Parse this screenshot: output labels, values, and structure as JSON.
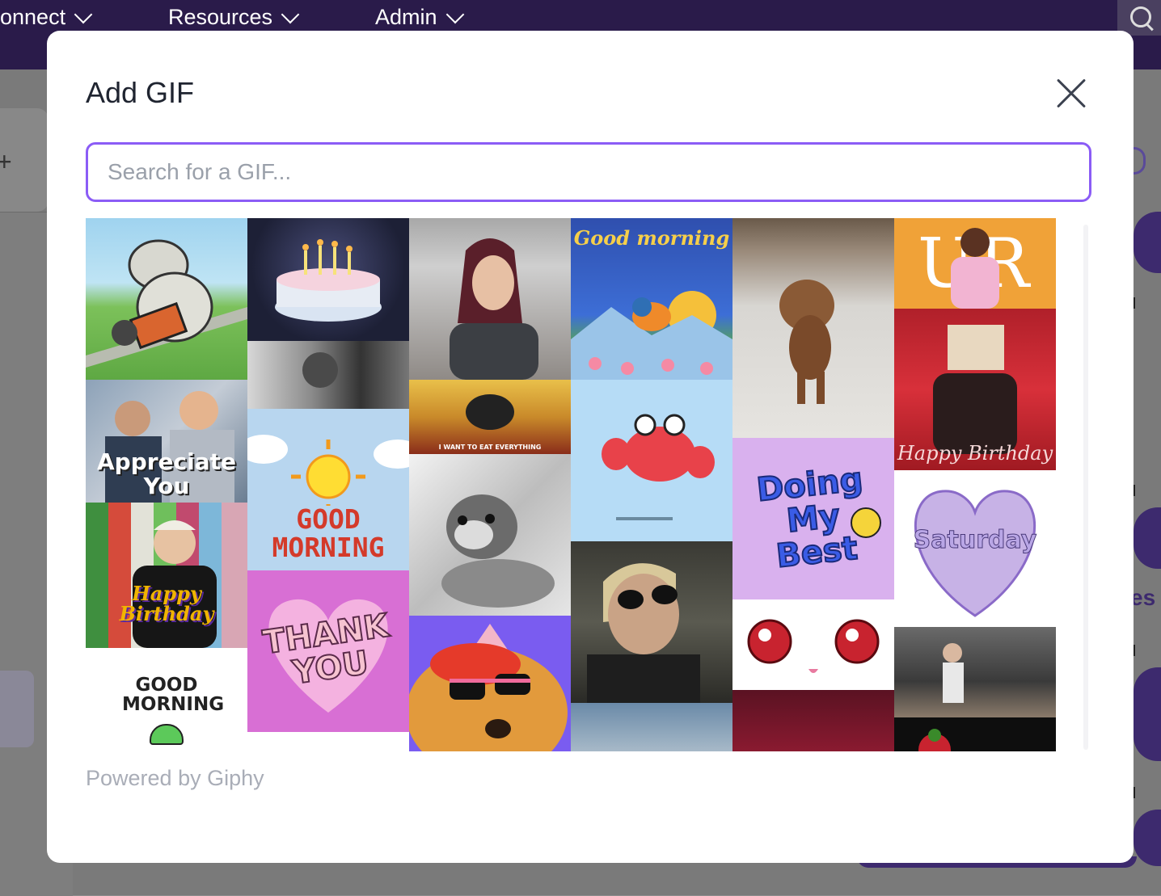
{
  "nav": {
    "items": [
      {
        "label": "onnect"
      },
      {
        "label": "Resources"
      },
      {
        "label": "Admin"
      }
    ],
    "search_icon": "search-icon"
  },
  "background": {
    "right_text": "es"
  },
  "modal": {
    "title": "Add GIF",
    "close_icon": "close-icon",
    "search": {
      "value": "",
      "placeholder": "Search for a GIF..."
    },
    "gifs": [
      {
        "id": "cow-scooter",
        "caption": ""
      },
      {
        "id": "birthday-cake",
        "caption": ""
      },
      {
        "id": "woman-smiling",
        "caption": ""
      },
      {
        "id": "good-morning-bird",
        "caption": "Good morning"
      },
      {
        "id": "poodle-walking",
        "caption": ""
      },
      {
        "id": "celebration-ur",
        "caption": "UR"
      },
      {
        "id": "man-in-office",
        "caption": ""
      },
      {
        "id": "i-want-to-eat-everything",
        "caption": "I WANT TO EAT EVERYTHING"
      },
      {
        "id": "happy-birthday-cake-head",
        "caption": "Happy Birthday"
      },
      {
        "id": "appreciate-you",
        "caption": "Appreciate You"
      },
      {
        "id": "good-morning-sun",
        "caption": "GOOD MORNING"
      },
      {
        "id": "red-crab",
        "caption": ""
      },
      {
        "id": "doing-my-best",
        "caption": "Doing My Best"
      },
      {
        "id": "saturday-heart",
        "caption": "Saturday"
      },
      {
        "id": "puppy-bw",
        "caption": ""
      },
      {
        "id": "happy-birthday-lady",
        "caption": "Happy Birthday"
      },
      {
        "id": "woman-sunglasses",
        "caption": ""
      },
      {
        "id": "anime-eyes",
        "caption": ""
      },
      {
        "id": "man-kitchen",
        "caption": ""
      },
      {
        "id": "thank-you-heart",
        "caption": "THANK YOU"
      },
      {
        "id": "orange-sunglasses",
        "caption": ""
      },
      {
        "id": "good-morning-frog",
        "caption": "GOOD MORNING"
      },
      {
        "id": "blue-scenery",
        "caption": ""
      },
      {
        "id": "dark-red-text",
        "caption": ""
      },
      {
        "id": "dark-fruit",
        "caption": ""
      }
    ],
    "footer": "Powered by Giphy"
  },
  "colors": {
    "accent": "#8b5cf6",
    "nav_bg": "#2a1b4a",
    "title": "#1f2430",
    "muted": "#a9adb7"
  }
}
